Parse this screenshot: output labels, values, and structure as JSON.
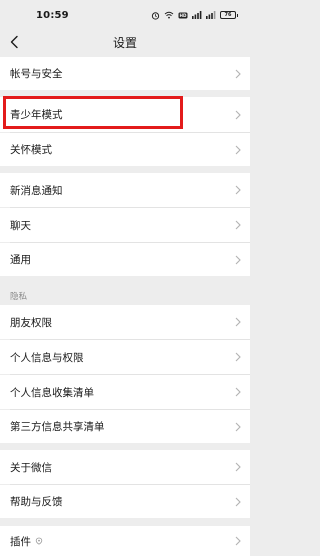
{
  "statusbar": {
    "time": "10:59",
    "icons": [
      "alarm-icon",
      "wifi-icon",
      "hd-icon",
      "signal-icon",
      "signal-icon",
      "battery-icon"
    ],
    "battery_level": "76"
  },
  "nav": {
    "title": "设置"
  },
  "groups": [
    {
      "items": [
        "帐号与安全"
      ]
    },
    {
      "items": [
        "青少年模式",
        "关怀模式"
      ]
    },
    {
      "items": [
        "新消息通知",
        "聊天",
        "通用"
      ]
    },
    {
      "section_label": "隐私",
      "items": [
        "朋友权限",
        "个人信息与权限",
        "个人信息收集清单",
        "第三方信息共享清单"
      ]
    },
    {
      "items": [
        "关于微信",
        "帮助与反馈"
      ]
    },
    {
      "items": [
        "插件"
      ]
    }
  ],
  "colors": {
    "background": "#ededed",
    "row_background": "#ffffff",
    "highlight_border": "#e31b1b",
    "section_label": "#8a8a8a"
  }
}
